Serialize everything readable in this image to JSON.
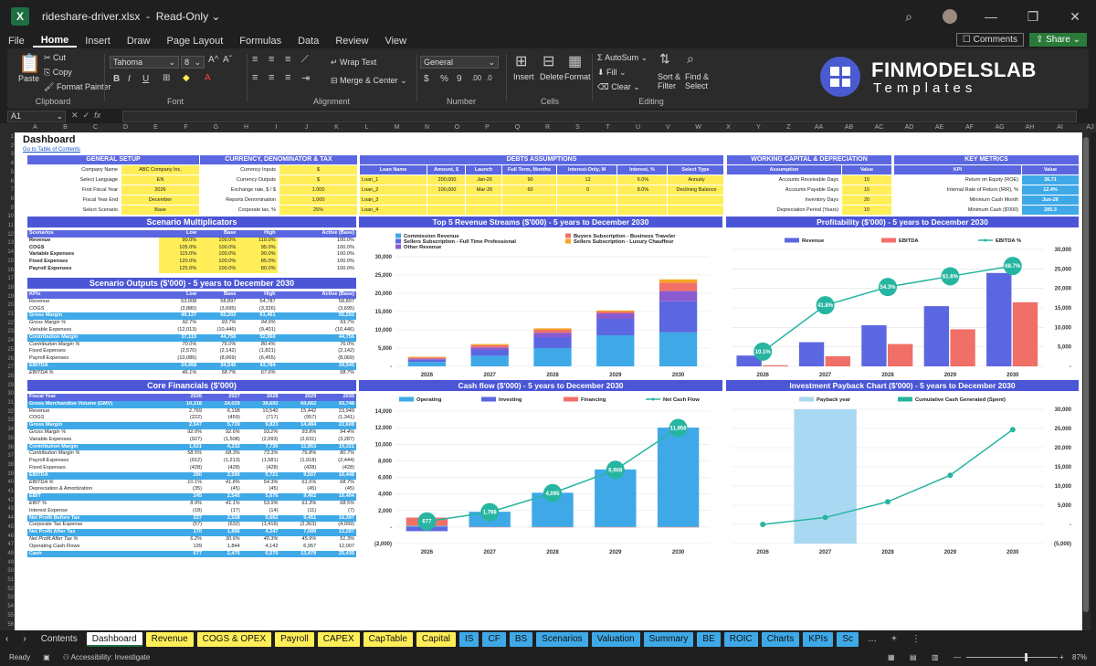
{
  "window": {
    "filename": "rideshare-driver.xlsx",
    "mode": "Read-Only"
  },
  "menu": [
    "File",
    "Home",
    "Insert",
    "Draw",
    "Page Layout",
    "Formulas",
    "Data",
    "Review",
    "View"
  ],
  "menu_right": {
    "comments": "Comments",
    "share": "Share"
  },
  "ribbon": {
    "clipboard": {
      "paste": "Paste",
      "cut": "Cut",
      "copy": "Copy",
      "format_painter": "Format Painter",
      "label": "Clipboard"
    },
    "font": {
      "name": "Tahoma",
      "size": "8",
      "label": "Font"
    },
    "alignment": {
      "wrap": "Wrap Text",
      "merge": "Merge & Center",
      "label": "Alignment"
    },
    "number": {
      "format": "General",
      "label": "Number"
    },
    "cells": {
      "insert": "Insert",
      "delete": "Delete",
      "format": "Format",
      "label": "Cells"
    },
    "editing": {
      "autosum": "AutoSum",
      "fill": "Fill",
      "clear": "Clear",
      "sort": "Sort & Filter",
      "find": "Find & Select",
      "label": "Editing"
    },
    "brand": {
      "title": "FINMODELSLAB",
      "subtitle": "Templates"
    }
  },
  "formula_bar": {
    "cell": "A1",
    "fx": "fx"
  },
  "columns": [
    "A",
    "B",
    "C",
    "D",
    "E",
    "F",
    "G",
    "H",
    "I",
    "J",
    "K",
    "L",
    "M",
    "N",
    "O",
    "P",
    "Q",
    "R",
    "S",
    "T",
    "U",
    "V",
    "W",
    "X",
    "Y",
    "Z",
    "AA",
    "AB",
    "AC",
    "AD",
    "AE",
    "AF",
    "AG",
    "AH",
    "AI",
    "AJ"
  ],
  "sheet": {
    "title": "Dashboard",
    "link": "Go to Table of Contents",
    "general": {
      "header": "GENERAL SETUP",
      "rows": [
        [
          "Company Name",
          "ABC Company Inc."
        ],
        [
          "Select Language",
          "EN"
        ],
        [
          "First Fiscal Year",
          "2026"
        ],
        [
          "Fiscal Year End",
          "December"
        ],
        [
          "Select Scenario",
          "Base"
        ]
      ]
    },
    "currency": {
      "header": "CURRENCY, DENOMINATOR & TAX",
      "rows": [
        [
          "Currency Inputs",
          "$"
        ],
        [
          "Currency Outputs",
          "$"
        ],
        [
          "Exchange rate, $ / $",
          "1.000"
        ],
        [
          "Reports Denomination",
          "1,000"
        ],
        [
          "Corporate tax, %",
          "25%"
        ]
      ]
    },
    "debts": {
      "header": "DEBTS ASSUMPTIONS",
      "cols": [
        "Loan Name",
        "Amount, $",
        "Launch",
        "Full Term, Months",
        "Interest-Only, M",
        "Interest, %",
        "Select Type"
      ],
      "rows": [
        [
          "Loan_1",
          "200,000",
          "Jan-26",
          "90",
          "12",
          "6.0%",
          "Annuity"
        ],
        [
          "Loan_2",
          "100,000",
          "Mar-26",
          "60",
          "0",
          "8.0%",
          "Declining Balance"
        ],
        [
          "Loan_3",
          "",
          "",
          "",
          "",
          "",
          ""
        ],
        [
          "Loan_4",
          "",
          "",
          "",
          "",
          "",
          ""
        ]
      ]
    },
    "wc": {
      "header": "WORKING CAPITAL & DEPRECIATION",
      "cols": [
        "Assumption",
        "Value"
      ],
      "rows": [
        [
          "Accounts Receivable Days",
          "15"
        ],
        [
          "Accounts Payable Days",
          "15"
        ],
        [
          "Inventory Days",
          "20"
        ],
        [
          "Depreciation Period (Years)",
          "10"
        ]
      ]
    },
    "kpi": {
      "header": "KEY METRICS",
      "cols": [
        "KPI",
        "Value"
      ],
      "rows": [
        [
          "Return on Equity (ROE)",
          "36.71"
        ],
        [
          "Internal Rate of Return (IRR), %",
          "12.4%"
        ],
        [
          "Minimum Cash Month",
          "Jun-26"
        ],
        [
          "Minimum Cash ($'000)",
          "285.3"
        ]
      ]
    },
    "multipliers": {
      "header": "Scenario Multiplicators",
      "cols": [
        "Scenarios",
        "Low",
        "Base",
        "High",
        "Active (Base)"
      ],
      "rows": [
        [
          "Revenue",
          "90.0%",
          "100.0%",
          "110.0%",
          "100.0%"
        ],
        [
          "COGS",
          "105.0%",
          "100.0%",
          "95.0%",
          "100.0%"
        ],
        [
          "Variable Expenses",
          "115.0%",
          "100.0%",
          "90.0%",
          "100.0%"
        ],
        [
          "Fixed Expenses",
          "120.0%",
          "100.0%",
          "85.0%",
          "100.0%"
        ],
        [
          "Payroll Expenses",
          "125.0%",
          "100.0%",
          "80.0%",
          "100.0%"
        ]
      ]
    },
    "outputs": {
      "header": "Scenario Outputs ($'000) - 5 years to December 2030",
      "cols": [
        "KPIs",
        "Low",
        "Base",
        "High",
        "Active (Base)"
      ],
      "rows": [
        {
          "s": "n",
          "c": [
            "Revenue",
            "53,008",
            "58,897",
            "64,787",
            "58,897"
          ]
        },
        {
          "s": "n",
          "c": [
            "COGS",
            "(3,880)",
            "(3,695)",
            "(3,326)",
            "(3,695)"
          ]
        },
        {
          "s": "hb",
          "c": [
            "Gross Margin",
            "49,127",
            "55,202",
            "61,461",
            "55,202"
          ]
        },
        {
          "s": "it",
          "c": [
            "Gross Margin %",
            "92.7%",
            "93.7%",
            "94.9%",
            "93.7%"
          ]
        },
        {
          "s": "n",
          "c": [
            "Variable Expenses",
            "(12,013)",
            "(10,446)",
            "(9,401)",
            "(10,446)"
          ]
        },
        {
          "s": "hb",
          "c": [
            "Contribution Margin",
            "37,115",
            "44,756",
            "52,060",
            "44,756"
          ]
        },
        {
          "s": "it",
          "c": [
            "Contribution Margin %",
            "70.0%",
            "76.0%",
            "80.4%",
            "76.0%"
          ]
        },
        {
          "s": "n",
          "c": [
            "Fixed Expenses",
            "(2,570)",
            "(2,142)",
            "(1,821)",
            "(2,142)"
          ]
        },
        {
          "s": "n",
          "c": [
            "Payroll Expenses",
            "(10,086)",
            "(8,069)",
            "(6,455)",
            "(8,069)"
          ]
        },
        {
          "s": "hb",
          "c": [
            "EBITDA",
            "24,458",
            "34,545",
            "43,784",
            "34,545"
          ]
        },
        {
          "s": "it",
          "c": [
            "EBITDA %",
            "46.1%",
            "58.7%",
            "67.6%",
            "58.7%"
          ]
        }
      ]
    },
    "core": {
      "header": "Core Financials ($'000)",
      "cols": [
        "Fiscal Year",
        "2026",
        "2027",
        "2028",
        "2029",
        "2030"
      ],
      "rows": [
        {
          "s": "hb",
          "c": [
            "Gross Merchandise Volume (GMV)",
            "10,318",
            "24,029",
            "38,692",
            "60,662",
            "93,748"
          ]
        },
        {
          "s": "n",
          "c": [
            "Revenue",
            "2,769",
            "6,198",
            "10,540",
            "15,442",
            "23,949"
          ]
        },
        {
          "s": "n",
          "c": [
            "COGS",
            "(222)",
            "(459)",
            "(717)",
            "(957)",
            "(1,341)"
          ]
        },
        {
          "s": "hb",
          "c": [
            "Gross Margin",
            "2,547",
            "5,739",
            "9,823",
            "14,484",
            "22,608"
          ]
        },
        {
          "s": "it",
          "c": [
            "Gross Margin %",
            "92.0%",
            "92.6%",
            "93.2%",
            "93.8%",
            "94.4%"
          ]
        },
        {
          "s": "n",
          "c": [
            "Variable Expenses",
            "(927)",
            "(1,508)",
            "(2,093)",
            "(2,631)",
            "(3,287)"
          ]
        },
        {
          "s": "hb",
          "c": [
            "Contribution Margin",
            "1,621",
            "4,232",
            "7,730",
            "11,853",
            "19,321"
          ]
        },
        {
          "s": "it",
          "c": [
            "Contribution Margin %",
            "58.5%",
            "68.3%",
            "73.3%",
            "76.8%",
            "80.7%"
          ]
        },
        {
          "s": "n",
          "c": [
            "Payroll Expenses",
            "(912)",
            "(1,213)",
            "(1,581)",
            "(1,918)",
            "(2,444)"
          ]
        },
        {
          "s": "n",
          "c": [
            "Fixed Expenses",
            "(428)",
            "(428)",
            "(428)",
            "(428)",
            "(428)"
          ]
        },
        {
          "s": "hb",
          "c": [
            "EBITDA",
            "280",
            "2,590",
            "5,721",
            "9,507",
            "16,448"
          ]
        },
        {
          "s": "it",
          "c": [
            "EBITDA %",
            "10.1%",
            "41.8%",
            "54.3%",
            "61.6%",
            "68.7%"
          ]
        },
        {
          "s": "n",
          "c": [
            "Depreciation & Amortization",
            "(35)",
            "(45)",
            "(45)",
            "(45)",
            "(45)"
          ]
        },
        {
          "s": "hb",
          "c": [
            "EBIT",
            "245",
            "2,545",
            "5,676",
            "9,462",
            "16,404"
          ]
        },
        {
          "s": "it",
          "c": [
            "EBIT %",
            "8.9%",
            "41.1%",
            "53.9%",
            "61.3%",
            "68.5%"
          ]
        },
        {
          "s": "n",
          "c": [
            "Interest Expense",
            "(18)",
            "(17)",
            "(14)",
            "(11)",
            "(7)"
          ]
        },
        {
          "s": "hb",
          "c": [
            "Net Profit Before Tax",
            "227",
            "2,528",
            "5,662",
            "9,451",
            "16,397"
          ]
        },
        {
          "s": "n",
          "c": [
            "Corporate Tax Expense",
            "(57)",
            "(632)",
            "(1,416)",
            "(2,363)",
            "(4,099)"
          ]
        },
        {
          "s": "hb",
          "c": [
            "Net Profit After Tax",
            "170",
            "1,896",
            "4,247",
            "7,089",
            "12,297"
          ]
        },
        {
          "s": "it",
          "c": [
            "Net Profit After Tax %",
            "6.2%",
            "30.6%",
            "40.3%",
            "45.9%",
            "51.3%"
          ]
        },
        {
          "s": "n",
          "c": [
            "Operating Cash Flows",
            "139",
            "1,844",
            "4,142",
            "6,957",
            "12,007"
          ]
        },
        {
          "s": "hb",
          "c": [
            "Cash",
            "677",
            "2,475",
            "6,570",
            "13,478",
            "25,435"
          ]
        }
      ]
    }
  },
  "chart_data": [
    {
      "type": "bar",
      "title": "Top 5 Revenue Streams ($'000) - 5 years to December 2030",
      "stacked": true,
      "categories": [
        "2026",
        "2027",
        "2028",
        "2029",
        "2030"
      ],
      "ylim": [
        0,
        30000
      ],
      "yticks": [
        "-",
        "5,000",
        "10,000",
        "15,000",
        "20,000",
        "25,000",
        "30,000"
      ],
      "legend_position": "top",
      "series": [
        {
          "name": "Commission Revenue",
          "color": "#3fa9e8",
          "values": [
            1200,
            2900,
            5000,
            8500,
            9300
          ]
        },
        {
          "name": "Sellers Subscription - Full Time Professional",
          "color": "#5b67e0",
          "values": [
            600,
            1600,
            3000,
            4500,
            8500
          ]
        },
        {
          "name": "Other Revenue",
          "color": "#8a5bd0",
          "values": [
            300,
            700,
            1200,
            1500,
            2800
          ]
        },
        {
          "name": "Buyers Subscription - Business Traveler",
          "color": "#f07068",
          "values": [
            300,
            600,
            800,
            500,
            2300
          ]
        },
        {
          "name": "Sellers Subscription - Luxury Chauffeur",
          "color": "#f5a623",
          "values": [
            200,
            300,
            400,
            300,
            900
          ]
        }
      ]
    },
    {
      "type": "bar",
      "title": "Profitability ($'000) - 5 years to December 2030",
      "categories": [
        "2026",
        "2027",
        "2028",
        "2029",
        "2030"
      ],
      "ylim": [
        0,
        30000
      ],
      "yticks": [
        "-",
        "5,000",
        "10,000",
        "15,000",
        "20,000",
        "25,000",
        "30,000"
      ],
      "y2lim": [
        0,
        0.8
      ],
      "legend_position": "top",
      "series": [
        {
          "name": "Revenue",
          "color": "#5b67e0",
          "values": [
            2769,
            6198,
            10540,
            15442,
            23949
          ]
        },
        {
          "name": "EBITDA",
          "color": "#f07068",
          "values": [
            280,
            2590,
            5721,
            9507,
            16448
          ]
        },
        {
          "name": "EBITDA %",
          "type": "line",
          "color": "#26b5a0",
          "values": [
            0.101,
            0.418,
            0.543,
            0.616,
            0.687
          ],
          "labels": [
            "10.1%",
            "41.8%",
            "54.3%",
            "61.6%",
            "68.7%"
          ]
        }
      ]
    },
    {
      "type": "bar",
      "title": "Cash flow ($'000) - 5 years to December 2030",
      "categories": [
        "2026",
        "2027",
        "2028",
        "2029",
        "2030"
      ],
      "ylim": [
        -2000,
        14000
      ],
      "yticks": [
        "(2,000)",
        "-",
        "2,000",
        "4,000",
        "6,000",
        "8,000",
        "10,000",
        "12,000",
        "14,000"
      ],
      "legend_position": "top",
      "series": [
        {
          "name": "Operating",
          "color": "#3fa9e8",
          "values": [
            139,
            1844,
            4142,
            6957,
            12007
          ]
        },
        {
          "name": "Investing",
          "color": "#5b67e0",
          "values": [
            -500,
            0,
            0,
            0,
            0
          ]
        },
        {
          "name": "Financing",
          "color": "#f07068",
          "values": [
            1000,
            -40,
            -47,
            -49,
            -51
          ]
        },
        {
          "name": "Net Cash Flow",
          "type": "line",
          "color": "#26b5a0",
          "values": [
            677,
            1798,
            4095,
            6908,
            11956
          ],
          "labels": [
            "677",
            "1,798",
            "4,095",
            "6,908",
            "11,956"
          ]
        }
      ]
    },
    {
      "type": "line",
      "title": "Investment Payback Chart ($'000) - 5 years to December 2030",
      "categories": [
        "2026",
        "2027",
        "2028",
        "2029",
        "2030"
      ],
      "ylim": [
        -5000,
        30000
      ],
      "yticks": [
        "(5,000)",
        "-",
        "5,000",
        "10,000",
        "15,000",
        "20,000",
        "25,000",
        "30,000"
      ],
      "legend_position": "top",
      "series": [
        {
          "name": "Payback year",
          "type": "band",
          "color": "#a9d8f2",
          "values": [
            0,
            1,
            0,
            0,
            0
          ]
        },
        {
          "name": "Cumulative Cash Generated (Spent)",
          "color": "#26b5a0",
          "values": [
            0,
            1800,
            5900,
            12800,
            24700
          ]
        }
      ]
    }
  ],
  "tabs": [
    {
      "t": "Contents",
      "k": "plain"
    },
    {
      "t": "Dashboard",
      "k": "active"
    },
    {
      "t": "Revenue",
      "k": "y"
    },
    {
      "t": "COGS & OPEX",
      "k": "y"
    },
    {
      "t": "Payroll",
      "k": "y"
    },
    {
      "t": "CAPEX",
      "k": "y"
    },
    {
      "t": "CapTable",
      "k": "y"
    },
    {
      "t": "Capital",
      "k": "y"
    },
    {
      "t": "IS",
      "k": "b"
    },
    {
      "t": "CF",
      "k": "b"
    },
    {
      "t": "BS",
      "k": "b"
    },
    {
      "t": "Scenarios",
      "k": "b"
    },
    {
      "t": "Valuation",
      "k": "b"
    },
    {
      "t": "Summary",
      "k": "b"
    },
    {
      "t": "BE",
      "k": "b"
    },
    {
      "t": "ROIC",
      "k": "b"
    },
    {
      "t": "Charts",
      "k": "b"
    },
    {
      "t": "KPIs",
      "k": "b"
    },
    {
      "t": "Sc",
      "k": "b"
    }
  ],
  "status": {
    "ready": "Ready",
    "accessibility": "Accessibility: Investigate",
    "zoom": "87%"
  }
}
